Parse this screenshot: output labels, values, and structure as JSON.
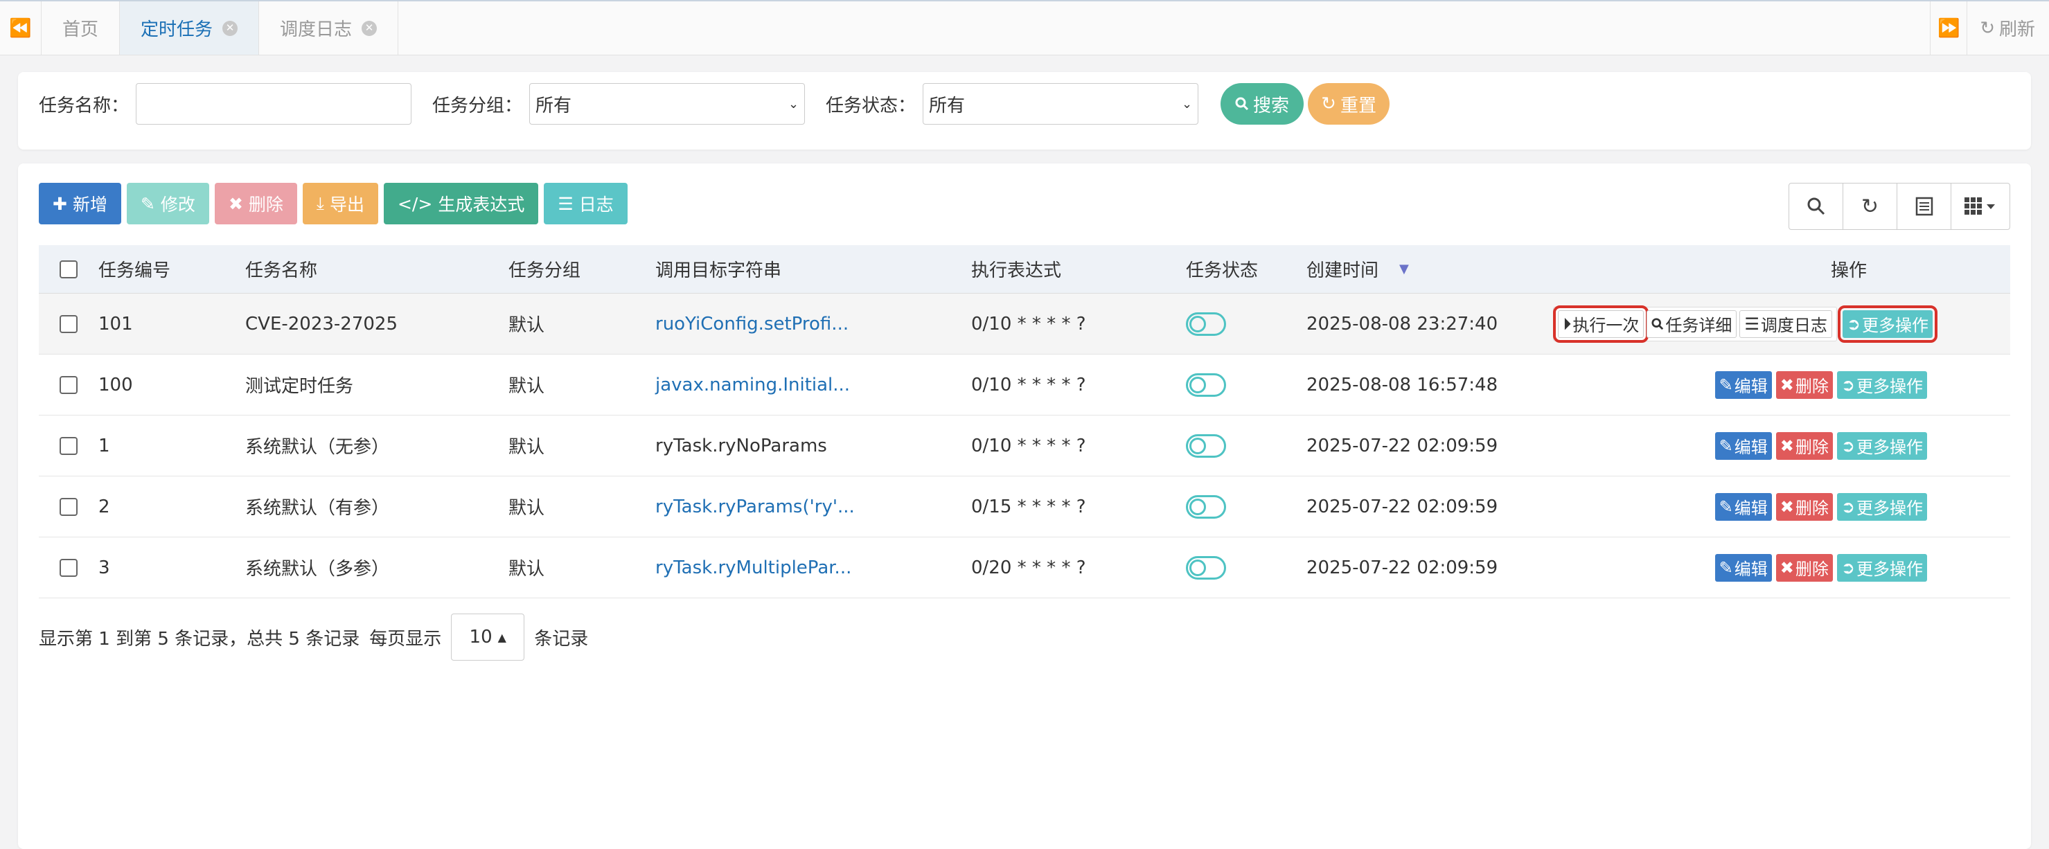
{
  "tabs": [
    {
      "label": "首页",
      "active": false,
      "closable": false
    },
    {
      "label": "定时任务",
      "active": true,
      "closable": true
    },
    {
      "label": "调度日志",
      "active": false,
      "closable": true
    }
  ],
  "tabbar": {
    "refresh_label": "刷新"
  },
  "search": {
    "task_name_label": "任务名称：",
    "task_name_value": "",
    "task_group_label": "任务分组：",
    "task_group_value": "所有",
    "task_status_label": "任务状态：",
    "task_status_value": "所有",
    "search_btn": "搜索",
    "reset_btn": "重置"
  },
  "toolbar": {
    "add": "新增",
    "edit": "修改",
    "delete": "删除",
    "export": "导出",
    "cron": "生成表达式",
    "log": "日志"
  },
  "table": {
    "headers": {
      "id": "任务编号",
      "name": "任务名称",
      "group": "任务分组",
      "target": "调用目标字符串",
      "cron": "执行表达式",
      "status": "任务状态",
      "created": "创建时间",
      "ops": "操作"
    },
    "rows": [
      {
        "id": "101",
        "name": "CVE-2023-27025",
        "group": "默认",
        "target": "ruoYiConfig.setProfi...",
        "cron": "0/10 * * * * ?",
        "created": "2025-08-08 23:27:40"
      },
      {
        "id": "100",
        "name": "测试定时任务",
        "group": "默认",
        "target": "javax.naming.Initial...",
        "cron": "0/10 * * * * ?",
        "created": "2025-08-08 16:57:48"
      },
      {
        "id": "1",
        "name": "系统默认（无参）",
        "group": "默认",
        "target": "ryTask.ryNoParams",
        "cron": "0/10 * * * * ?",
        "created": "2025-07-22 02:09:59"
      },
      {
        "id": "2",
        "name": "系统默认（有参）",
        "group": "默认",
        "target": "ryTask.ryParams('ry'...",
        "cron": "0/15 * * * * ?",
        "created": "2025-07-22 02:09:59"
      },
      {
        "id": "3",
        "name": "系统默认（多参）",
        "group": "默认",
        "target": "ryTask.ryMultiplePar...",
        "cron": "0/20 * * * * ?",
        "created": "2025-07-22 02:09:59"
      }
    ],
    "ops": {
      "edit": "编辑",
      "delete": "删除",
      "more": "更多操作",
      "run_once": "执行一次",
      "detail": "任务详细",
      "schedule_log": "调度日志"
    }
  },
  "pager": {
    "summary": "显示第 1 到第 5 条记录，总共 5 条记录",
    "per_page_label": "每页显示",
    "per_page_value": "10",
    "suffix": "条记录"
  },
  "colors": {
    "primary": "#3a7bc8",
    "danger": "#e05a5a",
    "info": "#5bc5c7",
    "success": "#4eb79a",
    "warning": "#f3b566",
    "highlight": "#d8322a"
  }
}
